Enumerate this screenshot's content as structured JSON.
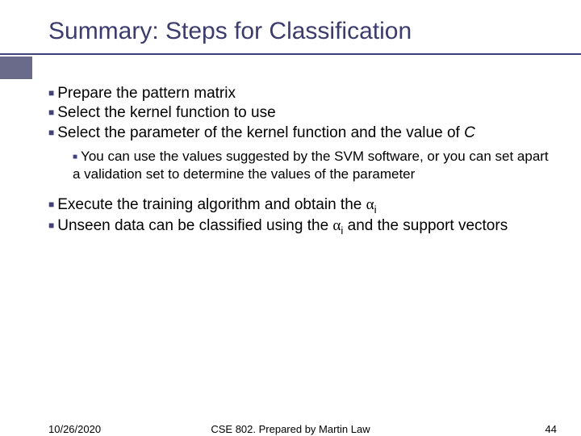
{
  "title": "Summary: Steps for Classification",
  "bullets": {
    "b1": "Prepare the pattern matrix",
    "b2": "Select the kernel function to use",
    "b3a": "Select the parameter of the kernel function and the value of ",
    "b3c": "C",
    "sub1": "You can use the values suggested by the SVM software, or you can set apart a validation set to determine the values of the parameter",
    "b4a": "Execute the training algorithm and obtain the ",
    "b5a": "Unseen data can be classified using the ",
    "b5b": " and the support vectors"
  },
  "alpha": "α",
  "subi": "i",
  "footer": {
    "date": "10/26/2020",
    "center": "CSE 802. Prepared by Martin Law",
    "page": "44"
  }
}
